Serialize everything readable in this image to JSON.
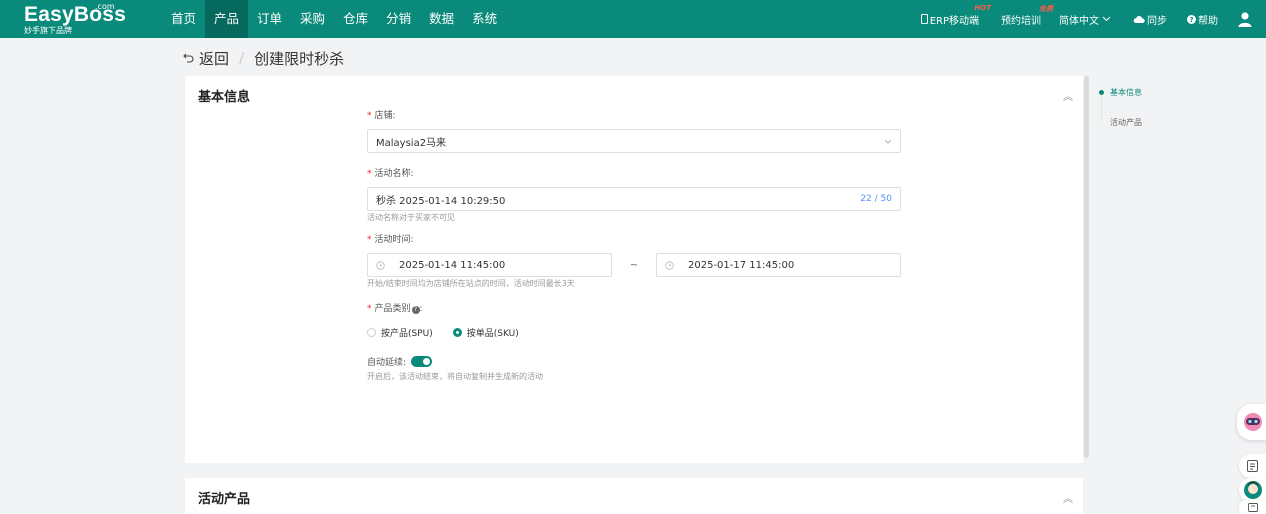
{
  "brand": {
    "name": "EasyBoss",
    "domain": ".com",
    "tagline": "妙手旗下品牌"
  },
  "nav": {
    "items": [
      "首页",
      "产品",
      "订单",
      "采购",
      "仓库",
      "分销",
      "数据",
      "系统"
    ],
    "active_index": 1
  },
  "topbar": {
    "erp_mobile": "ERP移动端",
    "erp_badge": "HOT",
    "training": "预约培训",
    "training_badge": "免费",
    "language": "简体中文",
    "sync": "同步",
    "help": "帮助"
  },
  "breadcrumb": {
    "back": "返回",
    "separator": "/",
    "current": "创建限时秒杀"
  },
  "basic": {
    "title": "基本信息",
    "shop_label": "店铺:",
    "shop_value": "Malaysia2马来",
    "name_label": "活动名称:",
    "name_value": "秒杀 2025-01-14 10:29:50",
    "name_count": "22 / 50",
    "name_hint": "活动名称对于买家不可见",
    "time_label": "活动时间:",
    "start_time": "2025-01-14 11:45:00",
    "time_sep": "~",
    "end_time": "2025-01-17 11:45:00",
    "time_hint": "开始/结束时间均为店铺所在站点的时间，活动时间最长3天",
    "category_label": "产品类别",
    "category_suffix": ":",
    "category_options": [
      "按产品(SPU)",
      "按单品(SKU)"
    ],
    "category_selected": 1,
    "auto_label": "自动延续:",
    "auto_on": true,
    "auto_hint": "开启后，该活动结束，将自动复制并生成新的活动"
  },
  "products": {
    "title": "活动产品"
  },
  "anchor": {
    "items": [
      "基本信息",
      "活动产品"
    ],
    "active_index": 0
  },
  "colors": {
    "primary": "#0a8a7a",
    "nav_active": "#06695d",
    "required": "#f5222d",
    "count": "#5b8ff9"
  }
}
